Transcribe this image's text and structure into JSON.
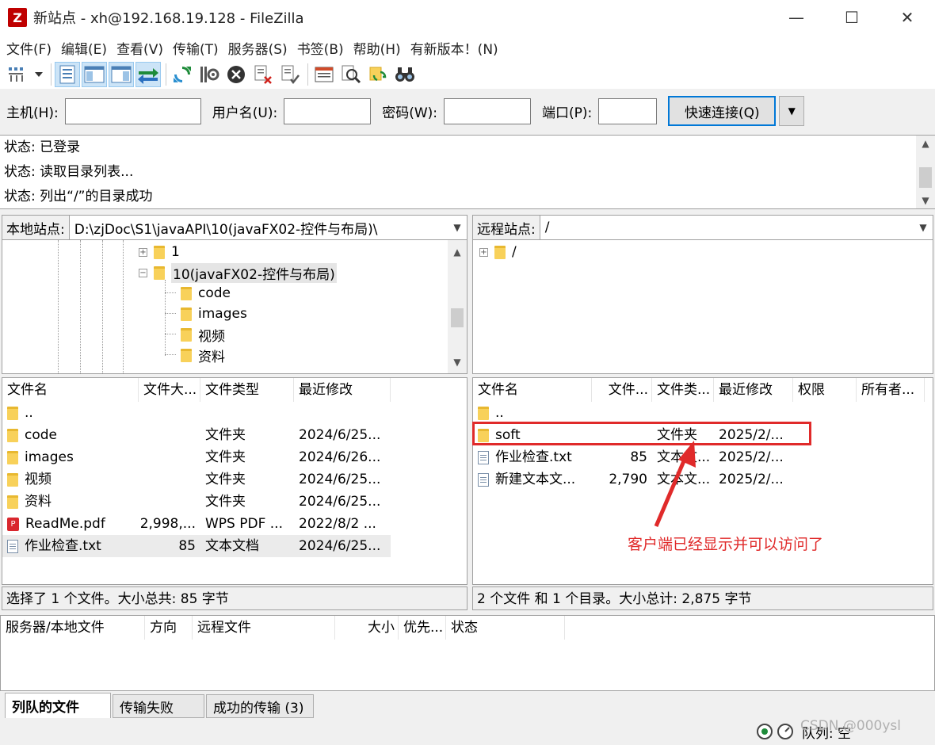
{
  "window": {
    "title": "新站点 - xh@192.168.19.128 - FileZilla",
    "app_icon_letter": "Z",
    "min": "—",
    "max": "☐",
    "close": "✕"
  },
  "menu": [
    "文件(F)",
    "编辑(E)",
    "查看(V)",
    "传输(T)",
    "服务器(S)",
    "书签(B)",
    "帮助(H)",
    "有新版本！(N)"
  ],
  "quickconnect": {
    "host_label": "主机(H):",
    "user_label": "用户名(U):",
    "pass_label": "密码(W):",
    "port_label": "端口(P):",
    "button": "快速连接(Q)",
    "dropdown": "▼",
    "host": "",
    "user": "",
    "pass": "",
    "port": ""
  },
  "log": [
    "状态:  已登录",
    "状态:  读取目录列表...",
    "状态:  列出“/”的目录成功"
  ],
  "local": {
    "site_label": "本地站点:",
    "path": "D:\\zjDoc\\S1\\javaAPI\\10(javaFX02-控件与布局)\\",
    "tree": [
      {
        "name": "1",
        "expander": "+"
      },
      {
        "name": "10(javaFX02-控件与布局)",
        "expander": "−"
      },
      {
        "name": "code"
      },
      {
        "name": "images"
      },
      {
        "name": "视频"
      },
      {
        "name": "资料"
      }
    ],
    "headers": [
      "文件名",
      "文件大...",
      "文件类型",
      "最近修改"
    ],
    "files": [
      {
        "name": "..",
        "size": "",
        "type": "",
        "modified": "",
        "icon": "folder"
      },
      {
        "name": "code",
        "size": "",
        "type": "文件夹",
        "modified": "2024/6/25...",
        "icon": "folder"
      },
      {
        "name": "images",
        "size": "",
        "type": "文件夹",
        "modified": "2024/6/26...",
        "icon": "folder"
      },
      {
        "name": "视频",
        "size": "",
        "type": "文件夹",
        "modified": "2024/6/25...",
        "icon": "folder"
      },
      {
        "name": "资料",
        "size": "",
        "type": "文件夹",
        "modified": "2024/6/25...",
        "icon": "folder"
      },
      {
        "name": "ReadMe.pdf",
        "size": "2,998,...",
        "type": "WPS PDF ...",
        "modified": "2022/8/2 ...",
        "icon": "pdf"
      },
      {
        "name": "作业检查.txt",
        "size": "85",
        "type": "文本文档",
        "modified": "2024/6/25...",
        "icon": "file",
        "selected": true
      }
    ],
    "status": "选择了 1 个文件。大小总共: 85 字节"
  },
  "remote": {
    "site_label": "远程站点:",
    "path": "/",
    "tree": [
      {
        "name": "/",
        "expander": "+"
      }
    ],
    "headers": [
      "文件名",
      "文件...",
      "文件类...",
      "最近修改",
      "权限",
      "所有者..."
    ],
    "files": [
      {
        "name": "..",
        "size": "",
        "type": "",
        "modified": "",
        "icon": "folder"
      },
      {
        "name": "soft",
        "size": "",
        "type": "文件夹",
        "modified": "2025/2/...",
        "icon": "folder"
      },
      {
        "name": "作业检查.txt",
        "size": "85",
        "type": "文本文...",
        "modified": "2025/2/...",
        "icon": "file"
      },
      {
        "name": "新建文本文...",
        "size": "2,790",
        "type": "文本文...",
        "modified": "2025/2/...",
        "icon": "file"
      }
    ],
    "status": "2 个文件 和 1 个目录。大小总计: 2,875 字节"
  },
  "queue": {
    "headers": [
      "服务器/本地文件",
      "方向",
      "远程文件",
      "大小",
      "优先...",
      "状态"
    ]
  },
  "tabs": [
    "列队的文件",
    "传输失败",
    "成功的传输 (3)"
  ],
  "statusbar": {
    "queue": "队列: 空"
  },
  "annotation": {
    "text": "客户端已经显示并可以访问了"
  },
  "watermark": "CSDN @000ysl",
  "colors": {
    "accent": "#0078d7",
    "annotation": "#e02a2a",
    "folder": "#f8d15a"
  }
}
